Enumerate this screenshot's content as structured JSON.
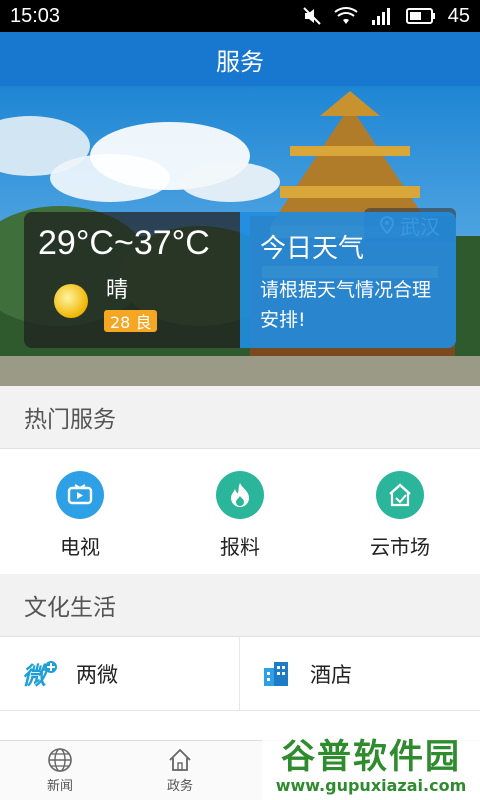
{
  "status_bar": {
    "time": "15:03",
    "battery": "45"
  },
  "app_bar": {
    "title": "服务"
  },
  "weather": {
    "city": "武汉",
    "temperature": "29°C~37°C",
    "condition": "晴",
    "aqi": "28 良",
    "tip_title": "今日天气",
    "tip_text": "请根据天气情况合理安排!"
  },
  "hot_services": {
    "header": "热门服务",
    "items": [
      {
        "label": "电视",
        "icon": "tv-icon",
        "color": "#2ea0e6"
      },
      {
        "label": "报料",
        "icon": "flame-icon",
        "color": "#2bb59a"
      },
      {
        "label": "云市场",
        "icon": "market-icon",
        "color": "#2bb59a"
      }
    ]
  },
  "culture": {
    "header": "文化生活",
    "items": [
      {
        "label": "两微",
        "icon": "weibo-weixin-icon"
      },
      {
        "label": "酒店",
        "icon": "hotel-icon"
      }
    ]
  },
  "bottom_nav": {
    "items": [
      {
        "label": "新闻",
        "icon": "globe-icon"
      },
      {
        "label": "政务",
        "icon": "home-icon"
      }
    ]
  },
  "watermark": {
    "title": "谷普软件园",
    "url": "www.gupuxiazai.com"
  }
}
